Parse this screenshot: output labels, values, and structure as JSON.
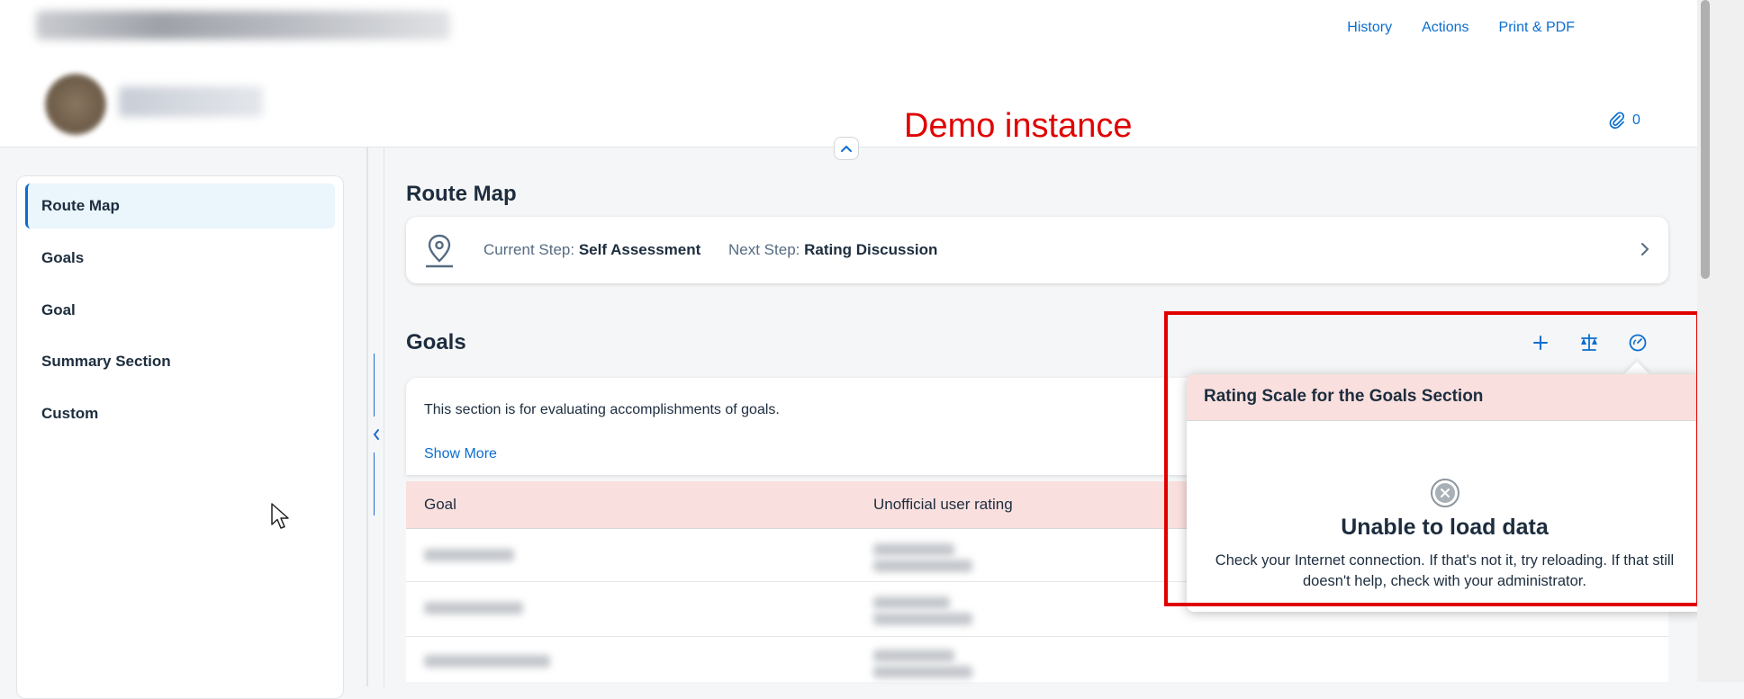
{
  "header": {
    "links": [
      "History",
      "Actions",
      "Print & PDF"
    ],
    "attachment_count": "0",
    "demo_label": "Demo instance"
  },
  "sidebar": {
    "items": [
      {
        "label": "Route Map",
        "active": true
      },
      {
        "label": "Goals",
        "active": false
      },
      {
        "label": "Goal",
        "active": false
      },
      {
        "label": "Summary Section",
        "active": false
      },
      {
        "label": "Custom",
        "active": false
      }
    ]
  },
  "route_map": {
    "title": "Route Map",
    "current_step_label": "Current Step:",
    "current_step_value": "Self Assessment",
    "next_step_label": "Next Step:",
    "next_step_value": "Rating Discussion"
  },
  "goals": {
    "title": "Goals",
    "description": "This section is for evaluating accomplishments of goals.",
    "show_more": "Show More",
    "columns": [
      "Goal",
      "Unofficial user rating"
    ],
    "tool_icons": [
      "add-icon",
      "balance-scale-icon",
      "gauge-icon"
    ]
  },
  "popover": {
    "title": "Rating Scale for the Goals Section",
    "error_title": "Unable to load data",
    "error_text": "Check your Internet connection. If that's not it, try reloading. If that still doesn't help, check with your administrator."
  },
  "colors": {
    "accent": "#0a6ed1",
    "header_highlight": "#f9e0de",
    "annotation_red": "#e00000"
  }
}
